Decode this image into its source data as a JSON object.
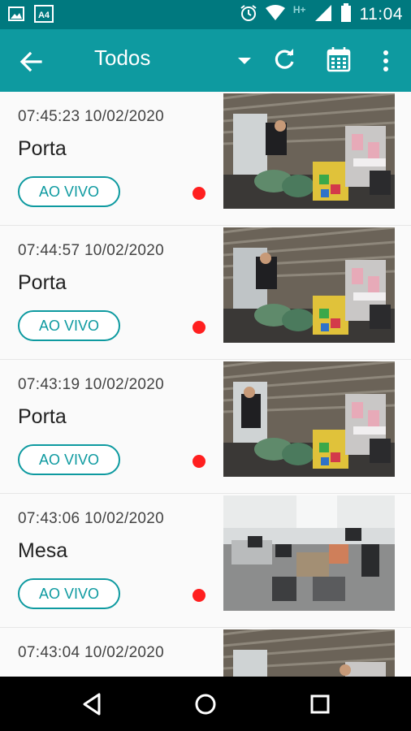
{
  "status_bar": {
    "time": "11:04",
    "network_label": "H+",
    "left_icons": [
      "image-icon",
      "a4-sim-icon"
    ],
    "right_icons": [
      "alarm-icon",
      "wifi-icon",
      "signal-icon",
      "battery-icon"
    ]
  },
  "app_bar": {
    "title": "Todos",
    "icons": [
      "back-arrow-icon",
      "dropdown-icon",
      "refresh-icon",
      "calendar-icon",
      "more-vert-icon"
    ]
  },
  "events": [
    {
      "time": "07:45:23  10/02/2020",
      "name": "Porta",
      "live_label": "AO VIVO",
      "scene": "porta-1"
    },
    {
      "time": "07:44:57  10/02/2020",
      "name": "Porta",
      "live_label": "AO VIVO",
      "scene": "porta-2"
    },
    {
      "time": "07:43:19  10/02/2020",
      "name": "Porta",
      "live_label": "AO VIVO",
      "scene": "porta-3"
    },
    {
      "time": "07:43:06  10/02/2020",
      "name": "Mesa",
      "live_label": "AO VIVO",
      "scene": "mesa"
    },
    {
      "time": "07:43:04  10/02/2020",
      "name": "",
      "live_label": "",
      "scene": "porta-4"
    }
  ],
  "colors": {
    "status_bar": "#00797f",
    "app_bar": "#0e9aa0",
    "accent": "#0e9aa0",
    "live_dot": "#ff1f1f"
  }
}
